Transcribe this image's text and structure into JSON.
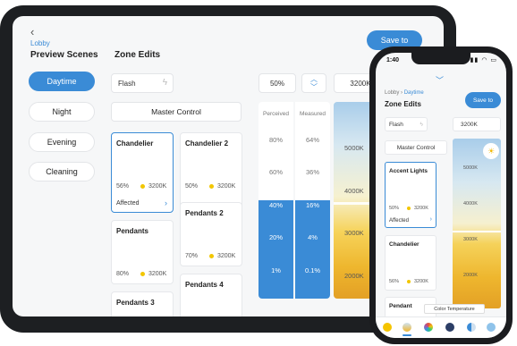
{
  "tablet": {
    "back_icon": "chevron-left-icon",
    "breadcrumb": "Lobby",
    "preview_scenes_title": "Preview Scenes",
    "zone_edits_title": "Zone Edits",
    "save_label": "Save to",
    "scenes": [
      "Daytime",
      "Night",
      "Evening",
      "Cleaning"
    ],
    "active_scene": "Daytime",
    "flash_label": "Flash",
    "flash_icon": "lightning-bolt-icon",
    "percent_value": "50%",
    "stepper_icon": "up-down-chevron-icon",
    "temp_value": "3200K",
    "master_control_label": "Master Control",
    "zones": [
      {
        "name": "Chandelier",
        "percent": "56%",
        "kelvin": "3200K",
        "affected": "Affected",
        "selected": true
      },
      {
        "name": "Chandelier 2",
        "percent": "50%",
        "kelvin": "3200K"
      },
      {
        "name": "Pendants",
        "percent": "80%",
        "kelvin": "3200K"
      },
      {
        "name": "Pendants 2",
        "percent": "70%",
        "kelvin": "3200K"
      },
      {
        "name": "Pendants 3"
      },
      {
        "name": "Pendants 4"
      }
    ],
    "meter": {
      "perceived_label": "Perceived",
      "measured_label": "Measured",
      "level_fraction": 0.5,
      "rows": [
        {
          "perceived": "80%",
          "measured": "64%"
        },
        {
          "perceived": "60%",
          "measured": "36%"
        },
        {
          "perceived": "40%",
          "measured": "16%"
        },
        {
          "perceived": "20%",
          "measured": "4%"
        },
        {
          "perceived": "1%",
          "measured": "0.1%"
        }
      ]
    },
    "color_temp_labels": [
      "5000K",
      "4000K",
      "3000K",
      "2000K"
    ]
  },
  "phone": {
    "time": "1:40",
    "status_icons": "signal-wifi-battery-icons",
    "collapse_icon": "chevron-down-icon",
    "breadcrumb_parent": "Lobby",
    "breadcrumb_current": "Daytime",
    "title": "Zone Edits",
    "save_label": "Save to",
    "flash_label": "Flash",
    "temp_value": "3200K",
    "master_control_label": "Master Control",
    "zones": [
      {
        "name": "Accent Lights",
        "percent": "50%",
        "kelvin": "3200K",
        "affected": "Affected",
        "selected": true
      },
      {
        "name": "Chandelier",
        "percent": "56%",
        "kelvin": "3200K"
      },
      {
        "name": "Pendant"
      }
    ],
    "color_temp_labels": [
      "5000K",
      "4000K",
      "3000K",
      "2000K"
    ],
    "tooltip": "Color Temperature",
    "tab_icons": [
      "sun-icon",
      "color-temp-icon",
      "color-wheel-icon",
      "scene-icon",
      "contrast-icon",
      "droplet-icon"
    ],
    "active_tab": 1,
    "colors": {
      "accent": "#3a8bd6",
      "warm": "#e3a025",
      "cool": "#a9cdea"
    }
  }
}
